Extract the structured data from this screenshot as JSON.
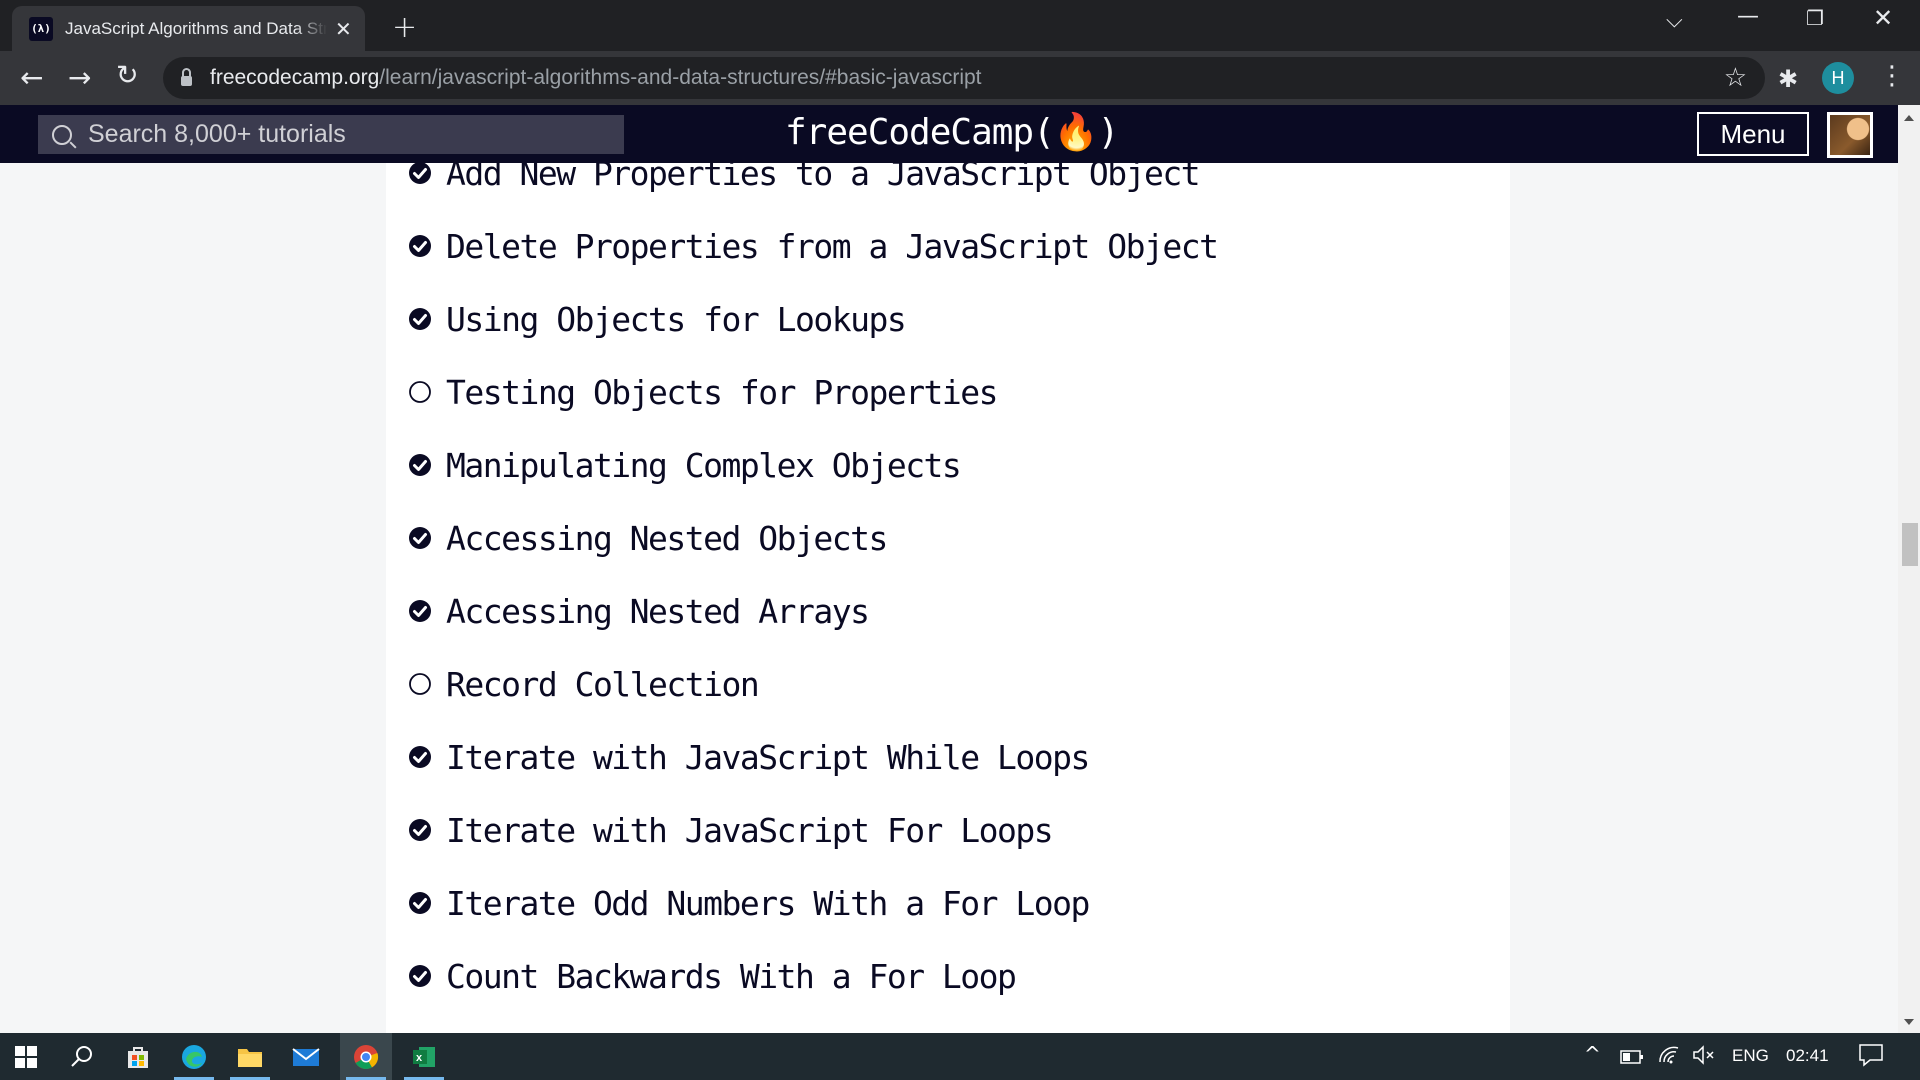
{
  "browser": {
    "tab_title": "JavaScript Algorithms and Data Structures | freeCodeCamp.org",
    "tab_favicon_text": "(λ)",
    "url_host": "freecodecamp.org",
    "url_path": "/learn/javascript-algorithms-and-data-structures/#basic-javascript",
    "profile_initial": "H"
  },
  "navbar": {
    "search_placeholder": "Search 8,000+ tutorials",
    "logo_text": "freeCodeCamp(🔥)",
    "menu_label": "Menu"
  },
  "lessons": [
    {
      "title": "Add New Properties to a JavaScript Object",
      "completed": true
    },
    {
      "title": "Delete Properties from a JavaScript Object",
      "completed": true
    },
    {
      "title": "Using Objects for Lookups",
      "completed": true
    },
    {
      "title": "Testing Objects for Properties",
      "completed": false
    },
    {
      "title": "Manipulating Complex Objects",
      "completed": true
    },
    {
      "title": "Accessing Nested Objects",
      "completed": true
    },
    {
      "title": "Accessing Nested Arrays",
      "completed": true
    },
    {
      "title": "Record Collection",
      "completed": false
    },
    {
      "title": "Iterate with JavaScript While Loops",
      "completed": true
    },
    {
      "title": "Iterate with JavaScript For Loops",
      "completed": true
    },
    {
      "title": "Iterate Odd Numbers With a For Loop",
      "completed": true
    },
    {
      "title": "Count Backwards With a For Loop",
      "completed": true
    }
  ],
  "taskbar": {
    "language": "ENG",
    "time": "02:41",
    "apps": [
      "start-icon",
      "search-icon",
      "store-icon",
      "edge-icon",
      "file-explorer-icon",
      "mail-icon",
      "chrome-icon",
      "excel-icon"
    ]
  },
  "colors": {
    "fcc_nav": "#0a0a23",
    "check_fill": "#0a0a23",
    "content_bg": "#ffffff",
    "page_bg": "#f5f6f7"
  }
}
